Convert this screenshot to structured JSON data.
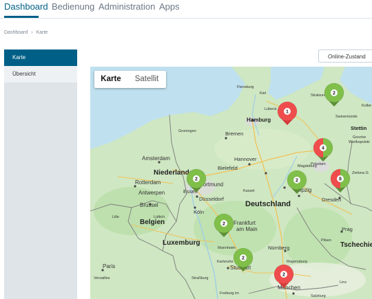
{
  "nav": {
    "tabs": [
      {
        "label": "Dashboard"
      },
      {
        "label": "Bedienung"
      },
      {
        "label": "Administration"
      },
      {
        "label": "Apps"
      }
    ]
  },
  "breadcrumb": {
    "items": [
      "Dashboard",
      "Karte"
    ],
    "separator": "›"
  },
  "sidebar": {
    "items": [
      {
        "label": "Karte"
      },
      {
        "label": "Übersicht"
      }
    ]
  },
  "status_button": {
    "label": "Online-Zustand"
  },
  "map": {
    "type_control": {
      "map_label": "Karte",
      "satellite_label": "Satellit"
    },
    "markers": [
      {
        "count": "1",
        "color": "red"
      },
      {
        "count": "2",
        "color": "green"
      },
      {
        "count": "4",
        "color": "red-green"
      },
      {
        "count": "2",
        "color": "green"
      },
      {
        "count": "8",
        "color": "red-green"
      },
      {
        "count": "2",
        "color": "green"
      },
      {
        "count": "2",
        "color": "green"
      },
      {
        "count": "2",
        "color": "green"
      },
      {
        "count": "2",
        "color": "red"
      }
    ],
    "labels": {
      "flensburg": "Flensburg",
      "kiel": "Kiel",
      "stralsund": "Stralsund",
      "kolbe": "Kolbe",
      "luebeck": "Lübeck",
      "hamburg": "Hamburg",
      "swinemuende": "Swinemünde",
      "stettin": "Stettin",
      "groningen": "Groningen",
      "bremen": "Bremen",
      "gorzow": "Gorzów",
      "wielkopolski": "Wielkopolski",
      "amsterdam": "Amsterdam",
      "hannover": "Hannover",
      "zielona": "Zielona G",
      "niederlande": "Niederlande",
      "bielefeld": "Bielefeld",
      "magdeburg": "Magdeburg",
      "potsdam": "Potsdam",
      "rotterdam": "Rotterdam",
      "dortmund": "Dortmund",
      "kassel": "Kassel",
      "antwerpen": "Antwerpen",
      "essen": "Essen",
      "duesseldorf": "Düsseldorf",
      "leipzig": "Leipzig",
      "dresden": "Dresden",
      "brussel": "Brussel",
      "deutschland": "Deutschland",
      "koeln": "Köln",
      "lille": "Lille",
      "luettich": "Lüttich",
      "belgien": "Belgien",
      "frankfurt": "Frankfurt",
      "am_main": "am Main",
      "prag": "Prag",
      "pilsen": "Pilsen",
      "tschechien": "Tschechien",
      "luxemburg": "Luxemburg",
      "mannheim": "Mannheim",
      "nuernberg": "Nürnberg",
      "paris": "Paris",
      "versailles": "Versailles",
      "karlsruhe": "Karlsruhe",
      "regensburg": "Regensburg",
      "stuttgart": "Stuttgart",
      "strassburg": "Straßburg",
      "muenchen": "München",
      "linz": "Linz",
      "freiburg": "Freiburg im",
      "salzburg": "Salzburg"
    }
  }
}
